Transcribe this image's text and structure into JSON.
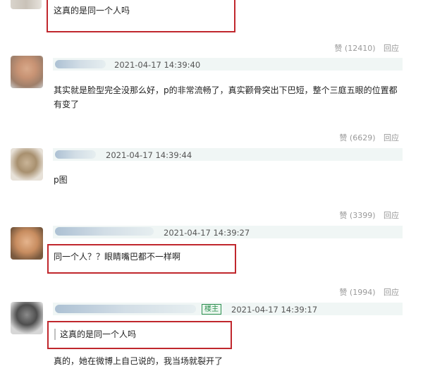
{
  "top_comment": {
    "text": "这真的是同一个人吗"
  },
  "comments": [
    {
      "timestamp": "2021-04-17 14:39:40",
      "content": "其实就是脸型完全没那么好，p的非常流畅了，真实颧骨突出下巴短，整个三庭五眼的位置都有变了",
      "likes_label": "赞 (6629)",
      "reply_label": "回应"
    },
    {
      "timestamp": "2021-04-17 14:39:44",
      "content": "p图",
      "likes_label": "赞 (3399)",
      "reply_label": "回应"
    },
    {
      "timestamp": "2021-04-17 14:39:27",
      "content": "同一个人？？眼睛嘴巴都不一样啊",
      "likes_label": "赞 (1994)",
      "reply_label": "回应"
    },
    {
      "timestamp": "2021-04-17 14:39:17",
      "badge": "楼主",
      "quote": "这真的是同一个人吗",
      "content": "真的，她在微博上自己说的，我当场就裂开了"
    }
  ],
  "top_actions": {
    "likes_label": "赞 (12410)",
    "reply_label": "回应"
  },
  "colors": {
    "highlight_border": "#c0272d",
    "meta_bar": "#f0f6f5",
    "badge": "#2c8f4f"
  }
}
